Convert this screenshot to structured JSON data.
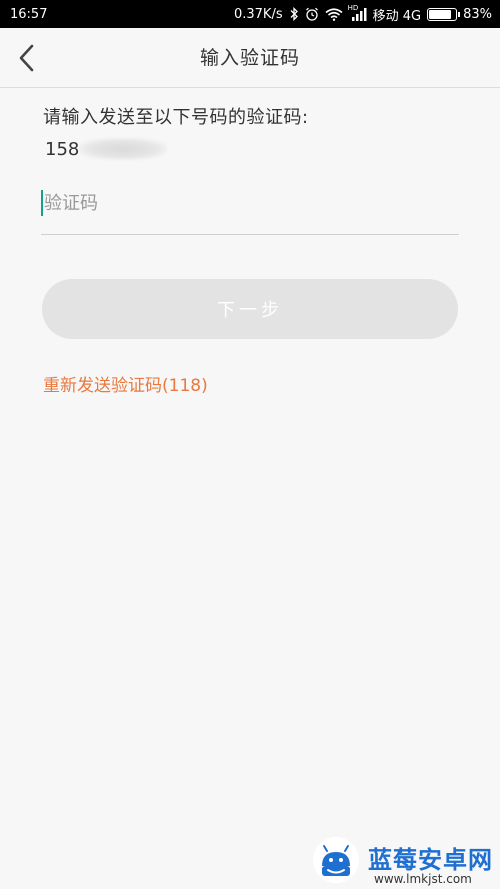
{
  "status_bar": {
    "time": "16:57",
    "speed": "0.37K/s",
    "carrier": "移动 4G",
    "battery": "83%",
    "battery_level": 0.83,
    "hd_label": "HD"
  },
  "header": {
    "title": "输入验证码",
    "back_icon": "chevron-left-icon"
  },
  "main": {
    "prompt": "请输入发送至以下号码的验证码:",
    "phone_visible": "158",
    "code_input": {
      "value": "",
      "placeholder": "验证码"
    },
    "next_button": "下一步",
    "resend_link": "重新发送验证码(118)"
  },
  "watermark": {
    "title": "蓝莓安卓网",
    "url": "www.lmkjst.com"
  },
  "colors": {
    "accent_orange": "#e8793f",
    "caret_green": "#14a08a",
    "disabled_button": "#e3e3e3",
    "watermark_blue": "#1f6fd1"
  }
}
